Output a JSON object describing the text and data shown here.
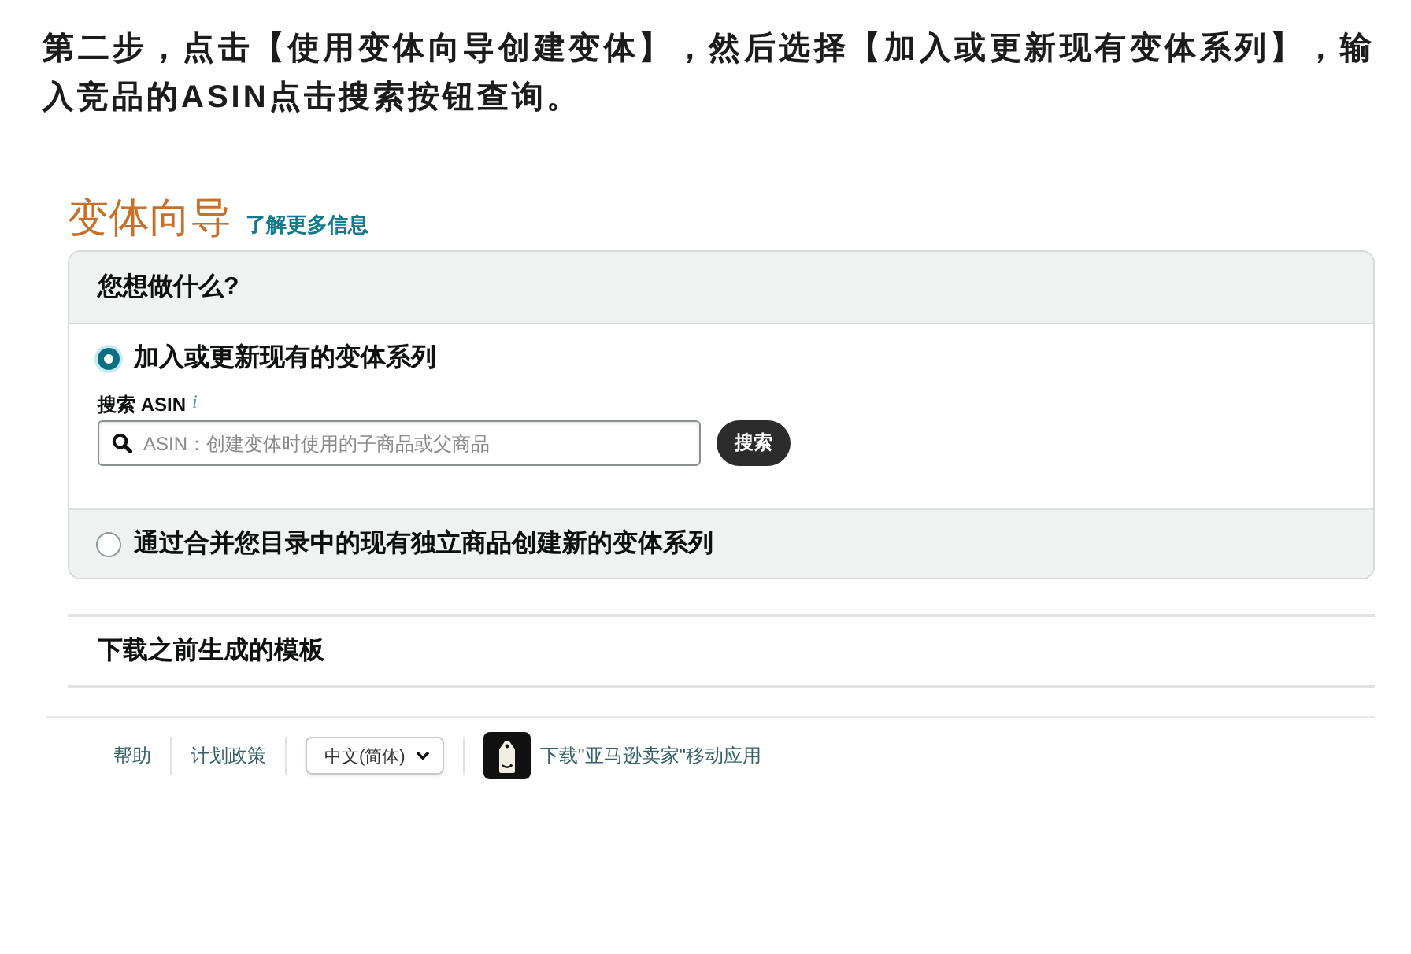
{
  "instruction": {
    "text": "第二步，点击【使用变体向导创建变体】，然后选择【加入或更新现有变体系列】，输入竞品的ASIN点击搜索按钮查询。"
  },
  "page": {
    "title": "变体向导",
    "learn_more_link": "了解更多信息"
  },
  "question": {
    "heading": "您想做什么?",
    "options": [
      {
        "label": "加入或更新现有的变体系列",
        "selected": true,
        "search": {
          "label": "搜索 ASIN",
          "info": "i",
          "placeholder": "ASIN：创建变体时使用的子商品或父商品",
          "button": "搜索"
        }
      },
      {
        "label": "通过合并您目录中的现有独立商品创建新的变体系列",
        "selected": false
      }
    ]
  },
  "download_section": {
    "title": "下载之前生成的模板"
  },
  "footer": {
    "links": [
      "帮助",
      "计划政策"
    ],
    "language_select": {
      "value": "中文(简体)"
    },
    "app_link": "下载\"亚马逊卖家\"移动应用"
  }
}
